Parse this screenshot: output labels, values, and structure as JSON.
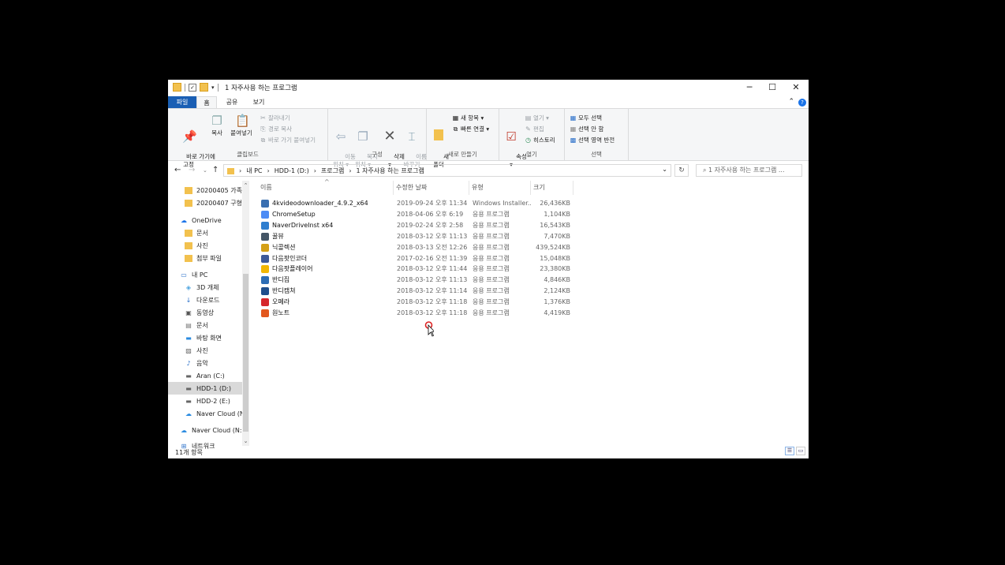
{
  "window": {
    "title": "1 자주사용 하는 프로그램",
    "minimize": "─",
    "maximize": "☐",
    "close": "✕"
  },
  "ribbon_tabs": [
    "파일",
    "홈",
    "공유",
    "보기"
  ],
  "ribbon": {
    "clipboard": {
      "pin": "바로 가기에\n고정",
      "copy": "복사",
      "paste": "붙여넣기",
      "cut": "잘라내기",
      "copy_path": "경로 복사",
      "paste_shortcut": "바로 가기 붙여넣기",
      "label": "클립보드"
    },
    "organize": {
      "move_to": "이동\n위치 ▾",
      "copy_to": "복사\n위치 ▾",
      "delete": "삭제\n▾",
      "rename": "이름\n바꾸기",
      "label": "구성"
    },
    "new": {
      "new_folder": "새\n폴더",
      "new_item": "새 항목 ▾",
      "easy_access": "빠른 연결 ▾",
      "label": "새로 만들기"
    },
    "open": {
      "properties": "속성\n▾",
      "open": "열기 ▾",
      "edit": "편집",
      "history": "히스토리",
      "label": "열기"
    },
    "select": {
      "select_all": "모두 선택",
      "select_none": "선택 안 함",
      "invert": "선택 영역 반전",
      "label": "선택"
    }
  },
  "address": {
    "crumbs": [
      "내 PC",
      "HDD-1 (D:)",
      "프로그램",
      "1 자주사용 하는 프로그램"
    ],
    "search_placeholder": "1 자주사용 하는 프로그램 ..."
  },
  "nav": [
    {
      "label": "20200405 가족",
      "icon": "folder-icon",
      "indent": 1
    },
    {
      "label": "20200407 구형",
      "icon": "folder-icon",
      "indent": 1
    },
    {
      "label": "OneDrive",
      "icon": "cloud-icon",
      "indent": 0
    },
    {
      "label": "문서",
      "icon": "folder-icon",
      "indent": 1
    },
    {
      "label": "사진",
      "icon": "folder-icon",
      "indent": 1
    },
    {
      "label": "첨부 파일",
      "icon": "folder-icon",
      "indent": 1
    },
    {
      "label": "내 PC",
      "icon": "pc-icon",
      "indent": 0
    },
    {
      "label": "3D 개체",
      "icon": "cube-icon",
      "indent": 1
    },
    {
      "label": "다운로드",
      "icon": "download-icon",
      "indent": 1
    },
    {
      "label": "동영상",
      "icon": "video-icon",
      "indent": 1
    },
    {
      "label": "문서",
      "icon": "document-icon",
      "indent": 1
    },
    {
      "label": "바탕 화면",
      "icon": "desktop-icon",
      "indent": 1
    },
    {
      "label": "사진",
      "icon": "picture-icon",
      "indent": 1
    },
    {
      "label": "음악",
      "icon": "music-icon",
      "indent": 1
    },
    {
      "label": "Aran (C:)",
      "icon": "drive-icon",
      "indent": 1
    },
    {
      "label": "HDD-1 (D:)",
      "icon": "drive-icon",
      "indent": 1
    },
    {
      "label": "HDD-2 (E:)",
      "icon": "drive-icon",
      "indent": 1
    },
    {
      "label": "Naver Cloud (N:",
      "icon": "cloud-drive-icon",
      "indent": 1
    },
    {
      "label": "Naver Cloud (N:)",
      "icon": "cloud-drive-icon",
      "indent": 0
    },
    {
      "label": "네트워크",
      "icon": "network-icon",
      "indent": 0
    }
  ],
  "columns": [
    "이름",
    "수정한 날짜",
    "유형",
    "크기"
  ],
  "files": [
    {
      "name": "4kvideodownloader_4.9.2_x64",
      "date": "2019-09-24 오후 11:34",
      "type": "Windows Installer...",
      "size": "26,436KB",
      "color": "#3a6fb0"
    },
    {
      "name": "ChromeSetup",
      "date": "2018-04-06 오후 6:19",
      "type": "응용 프로그램",
      "size": "1,104KB",
      "color": "#4c8bf5"
    },
    {
      "name": "NaverDriveInst x64",
      "date": "2019-02-24 오후 2:58",
      "type": "응용 프로그램",
      "size": "16,543KB",
      "color": "#2f7ecf"
    },
    {
      "name": "꿀뷰",
      "date": "2018-03-12 오후 11:13",
      "type": "응용 프로그램",
      "size": "7,470KB",
      "color": "#445566"
    },
    {
      "name": "닉콜렉션",
      "date": "2018-03-13 오전 12:26",
      "type": "응용 프로그램",
      "size": "439,524KB",
      "color": "#d4a017"
    },
    {
      "name": "다음팟인코더",
      "date": "2017-02-16 오전 11:39",
      "type": "응용 프로그램",
      "size": "15,048KB",
      "color": "#3d5a99"
    },
    {
      "name": "다음팟플레이어",
      "date": "2018-03-12 오후 11:44",
      "type": "응용 프로그램",
      "size": "23,380KB",
      "color": "#f2b705"
    },
    {
      "name": "반디집",
      "date": "2018-03-12 오후 11:13",
      "type": "응용 프로그램",
      "size": "4,846KB",
      "color": "#2d6db5"
    },
    {
      "name": "반디캠쳐",
      "date": "2018-03-12 오후 11:14",
      "type": "응용 프로그램",
      "size": "2,124KB",
      "color": "#1f4e8c"
    },
    {
      "name": "오페라",
      "date": "2018-03-12 오후 11:18",
      "type": "응용 프로그램",
      "size": "1,376KB",
      "color": "#d6262b"
    },
    {
      "name": "원노트",
      "date": "2018-03-12 오후 11:18",
      "type": "응용 프로그램",
      "size": "4,419KB",
      "color": "#e2571e"
    }
  ],
  "status": "11개 항목"
}
